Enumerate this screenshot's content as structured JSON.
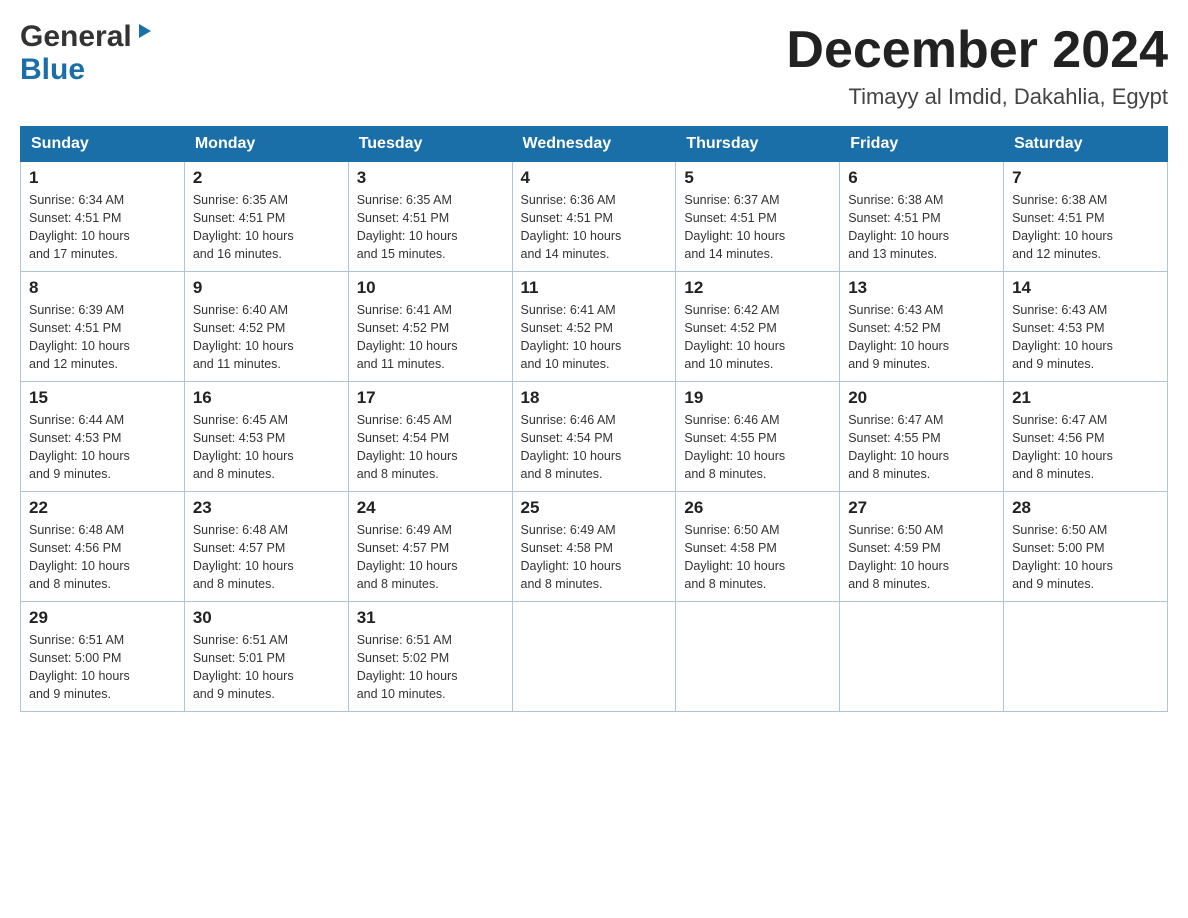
{
  "header": {
    "logo_general": "General",
    "logo_blue": "Blue",
    "month_title": "December 2024",
    "location": "Timayy al Imdid, Dakahlia, Egypt"
  },
  "days_of_week": [
    "Sunday",
    "Monday",
    "Tuesday",
    "Wednesday",
    "Thursday",
    "Friday",
    "Saturday"
  ],
  "weeks": [
    [
      {
        "day": "1",
        "sunrise": "6:34 AM",
        "sunset": "4:51 PM",
        "daylight": "10 hours and 17 minutes."
      },
      {
        "day": "2",
        "sunrise": "6:35 AM",
        "sunset": "4:51 PM",
        "daylight": "10 hours and 16 minutes."
      },
      {
        "day": "3",
        "sunrise": "6:35 AM",
        "sunset": "4:51 PM",
        "daylight": "10 hours and 15 minutes."
      },
      {
        "day": "4",
        "sunrise": "6:36 AM",
        "sunset": "4:51 PM",
        "daylight": "10 hours and 14 minutes."
      },
      {
        "day": "5",
        "sunrise": "6:37 AM",
        "sunset": "4:51 PM",
        "daylight": "10 hours and 14 minutes."
      },
      {
        "day": "6",
        "sunrise": "6:38 AM",
        "sunset": "4:51 PM",
        "daylight": "10 hours and 13 minutes."
      },
      {
        "day": "7",
        "sunrise": "6:38 AM",
        "sunset": "4:51 PM",
        "daylight": "10 hours and 12 minutes."
      }
    ],
    [
      {
        "day": "8",
        "sunrise": "6:39 AM",
        "sunset": "4:51 PM",
        "daylight": "10 hours and 12 minutes."
      },
      {
        "day": "9",
        "sunrise": "6:40 AM",
        "sunset": "4:52 PM",
        "daylight": "10 hours and 11 minutes."
      },
      {
        "day": "10",
        "sunrise": "6:41 AM",
        "sunset": "4:52 PM",
        "daylight": "10 hours and 11 minutes."
      },
      {
        "day": "11",
        "sunrise": "6:41 AM",
        "sunset": "4:52 PM",
        "daylight": "10 hours and 10 minutes."
      },
      {
        "day": "12",
        "sunrise": "6:42 AM",
        "sunset": "4:52 PM",
        "daylight": "10 hours and 10 minutes."
      },
      {
        "day": "13",
        "sunrise": "6:43 AM",
        "sunset": "4:52 PM",
        "daylight": "10 hours and 9 minutes."
      },
      {
        "day": "14",
        "sunrise": "6:43 AM",
        "sunset": "4:53 PM",
        "daylight": "10 hours and 9 minutes."
      }
    ],
    [
      {
        "day": "15",
        "sunrise": "6:44 AM",
        "sunset": "4:53 PM",
        "daylight": "10 hours and 9 minutes."
      },
      {
        "day": "16",
        "sunrise": "6:45 AM",
        "sunset": "4:53 PM",
        "daylight": "10 hours and 8 minutes."
      },
      {
        "day": "17",
        "sunrise": "6:45 AM",
        "sunset": "4:54 PM",
        "daylight": "10 hours and 8 minutes."
      },
      {
        "day": "18",
        "sunrise": "6:46 AM",
        "sunset": "4:54 PM",
        "daylight": "10 hours and 8 minutes."
      },
      {
        "day": "19",
        "sunrise": "6:46 AM",
        "sunset": "4:55 PM",
        "daylight": "10 hours and 8 minutes."
      },
      {
        "day": "20",
        "sunrise": "6:47 AM",
        "sunset": "4:55 PM",
        "daylight": "10 hours and 8 minutes."
      },
      {
        "day": "21",
        "sunrise": "6:47 AM",
        "sunset": "4:56 PM",
        "daylight": "10 hours and 8 minutes."
      }
    ],
    [
      {
        "day": "22",
        "sunrise": "6:48 AM",
        "sunset": "4:56 PM",
        "daylight": "10 hours and 8 minutes."
      },
      {
        "day": "23",
        "sunrise": "6:48 AM",
        "sunset": "4:57 PM",
        "daylight": "10 hours and 8 minutes."
      },
      {
        "day": "24",
        "sunrise": "6:49 AM",
        "sunset": "4:57 PM",
        "daylight": "10 hours and 8 minutes."
      },
      {
        "day": "25",
        "sunrise": "6:49 AM",
        "sunset": "4:58 PM",
        "daylight": "10 hours and 8 minutes."
      },
      {
        "day": "26",
        "sunrise": "6:50 AM",
        "sunset": "4:58 PM",
        "daylight": "10 hours and 8 minutes."
      },
      {
        "day": "27",
        "sunrise": "6:50 AM",
        "sunset": "4:59 PM",
        "daylight": "10 hours and 8 minutes."
      },
      {
        "day": "28",
        "sunrise": "6:50 AM",
        "sunset": "5:00 PM",
        "daylight": "10 hours and 9 minutes."
      }
    ],
    [
      {
        "day": "29",
        "sunrise": "6:51 AM",
        "sunset": "5:00 PM",
        "daylight": "10 hours and 9 minutes."
      },
      {
        "day": "30",
        "sunrise": "6:51 AM",
        "sunset": "5:01 PM",
        "daylight": "10 hours and 9 minutes."
      },
      {
        "day": "31",
        "sunrise": "6:51 AM",
        "sunset": "5:02 PM",
        "daylight": "10 hours and 10 minutes."
      },
      null,
      null,
      null,
      null
    ]
  ],
  "labels": {
    "sunrise": "Sunrise:",
    "sunset": "Sunset:",
    "daylight": "Daylight:"
  }
}
